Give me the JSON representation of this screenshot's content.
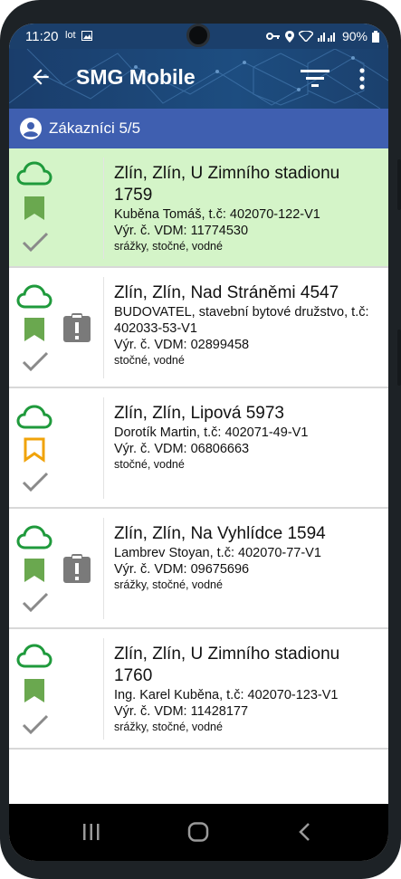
{
  "status_bar": {
    "time": "11:20",
    "carrier": "lot",
    "battery": "90%"
  },
  "app_bar": {
    "title": "SMG Mobile"
  },
  "subheader": {
    "label": "Zákazníci 5/5"
  },
  "customers": [
    {
      "address": "Zlín, Zlín, U Zimního stadionu 1759",
      "owner": "Kuběna Tomáš, t.č: 402070-122-V1",
      "meter": "Výr. č. VDM: 11774530",
      "fees": "srážky, stočné, vodné",
      "bookmark_color": "#6aa84f",
      "has_warning": false,
      "selected": true
    },
    {
      "address": "Zlín, Zlín, Nad Stráněmi 4547",
      "owner": "BUDOVATEL, stavební bytové družstvo, t.č: 402033-53-V1",
      "meter": "Výr. č. VDM: 02899458",
      "fees": "stočné, vodné",
      "bookmark_color": "#6aa84f",
      "has_warning": true,
      "selected": false
    },
    {
      "address": "Zlín, Zlín, Lipová 5973",
      "owner": "Dorotík Martin, t.č: 402071-49-V1",
      "meter": "Výr. č. VDM: 06806663",
      "fees": "stočné, vodné",
      "bookmark_color": "#f0a30a",
      "has_warning": false,
      "selected": false
    },
    {
      "address": "Zlín, Zlín, Na Vyhlídce 1594",
      "owner": "Lambrev Stoyan, t.č: 402070-77-V1",
      "meter": "Výr. č. VDM: 09675696",
      "fees": "srážky, stočné, vodné",
      "bookmark_color": "#6aa84f",
      "has_warning": true,
      "selected": false
    },
    {
      "address": "Zlín, Zlín, U Zimního stadionu 1760",
      "owner": "Ing. Karel Kuběna, t.č: 402070-123-V1",
      "meter": "Výr. č. VDM: 11428177",
      "fees": "srážky, stočné, vodné",
      "bookmark_color": "#6aa84f",
      "has_warning": false,
      "selected": false
    }
  ],
  "icons": {
    "back": "arrow-left-icon",
    "filter": "filter-icon",
    "more": "more-vert-icon",
    "account": "account-circle-icon",
    "sync": "cloud-icon",
    "bookmark": "bookmark-icon",
    "done": "check-icon",
    "warning": "clipboard-alert-icon"
  },
  "colors": {
    "app_bar": "#1d4d80",
    "subheader": "#3f5fb0",
    "selected_row": "#d4f4c8",
    "cloud": "#1f9a3c",
    "bookmark_green": "#6aa84f",
    "bookmark_orange": "#f0a30a"
  }
}
